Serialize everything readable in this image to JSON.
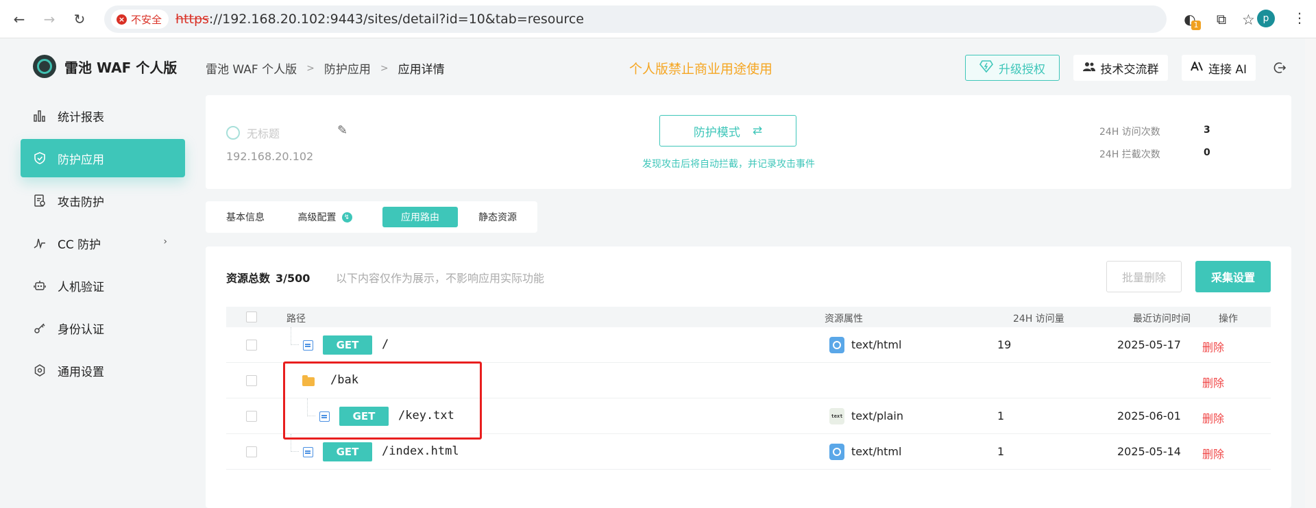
{
  "browser": {
    "security_label": "不安全",
    "url_scheme": "https",
    "url_rest": "://192.168.20.102:9443/sites/detail?id=10&tab=resource",
    "extension_badge": "1",
    "profile_initial": "p"
  },
  "sidebar": {
    "brand": "雷池 WAF 个人版",
    "items": [
      {
        "label": "统计报表",
        "icon": "bar-chart-icon"
      },
      {
        "label": "防护应用",
        "icon": "shield-icon",
        "active": true
      },
      {
        "label": "攻击防护",
        "icon": "document-check-icon"
      },
      {
        "label": "CC 防护",
        "icon": "pulse-icon",
        "has_children": true
      },
      {
        "label": "人机验证",
        "icon": "robot-icon"
      },
      {
        "label": "身份认证",
        "icon": "key-icon"
      },
      {
        "label": "通用设置",
        "icon": "gear-icon"
      }
    ]
  },
  "header": {
    "breadcrumb": [
      "雷池 WAF 个人版",
      "防护应用",
      "应用详情"
    ],
    "notice": "个人版禁止商业用途使用",
    "upgrade_label": "升级授权",
    "group_label": "技术交流群",
    "ai_label": "连接 AI"
  },
  "site": {
    "title": "无标题",
    "ip": "192.168.20.102",
    "mode_label": "防护模式",
    "mode_desc": "发现攻击后将自动拦截，并记录攻击事件",
    "stats": [
      {
        "label": "24H 访问次数",
        "value": "3"
      },
      {
        "label": "24H 拦截次数",
        "value": "0"
      }
    ]
  },
  "tabs": [
    {
      "label": "基本信息"
    },
    {
      "label": "高级配置",
      "badge": "↯"
    },
    {
      "label": "应用路由",
      "active": true
    },
    {
      "label": "静态资源"
    }
  ],
  "resources": {
    "total_label": "资源总数",
    "total_count": "3/500",
    "hint": "以下内容仅作为展示，不影响应用实际功能",
    "batch_delete_label": "批量删除",
    "collect_label": "采集设置",
    "columns": [
      "路径",
      "资源属性",
      "24H 访问量",
      "最近访问时间",
      "操作"
    ],
    "rows": [
      {
        "type": "file",
        "method": "GET",
        "path": "/",
        "mime": "text/html",
        "mime_icon": "html-icon",
        "visits": "19",
        "last": "2025-05-17",
        "action": "删除"
      },
      {
        "type": "folder",
        "path": "/bak",
        "action": "删除"
      },
      {
        "type": "file",
        "method": "GET",
        "path": "/key.txt",
        "mime": "text/plain",
        "mime_icon": "txt-icon",
        "visits": "1",
        "last": "2025-06-01",
        "action": "删除"
      },
      {
        "type": "file",
        "method": "GET",
        "path": "/index.html",
        "mime": "text/html",
        "mime_icon": "html-icon",
        "visits": "1",
        "last": "2025-05-14",
        "action": "删除"
      }
    ]
  },
  "colors": {
    "accent": "#3ec6b9",
    "notice": "#f5a623",
    "danger": "#f04848",
    "highlight": "#e81e1e"
  }
}
